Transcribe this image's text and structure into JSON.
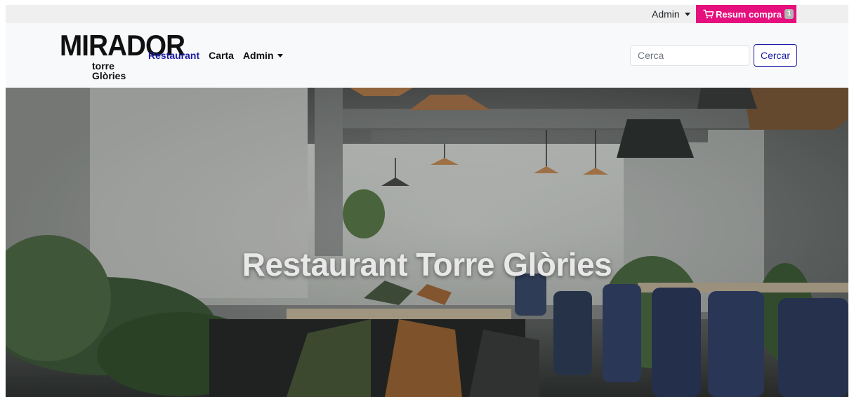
{
  "topbar": {
    "admin_label": "Admin",
    "cart": {
      "label": "Resum compra",
      "count": "1",
      "color": "#e5107e"
    }
  },
  "navbar": {
    "logo": {
      "main": "MIRADOR",
      "line1": "torre",
      "line2": "Glòries"
    },
    "links": [
      {
        "label": "Restaurant",
        "active": true
      },
      {
        "label": "Carta"
      },
      {
        "label": "Admin"
      }
    ],
    "search": {
      "placeholder": "Cerca",
      "button_label": "Cercar"
    },
    "accent_color": "#1a1aa6"
  },
  "hero": {
    "title": "Restaurant Torre Glòries"
  }
}
